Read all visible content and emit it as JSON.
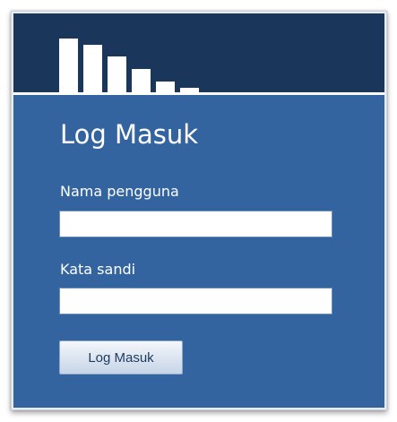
{
  "logo": {
    "icon": "bar-chart-logo-icon",
    "bars": [
      {
        "level": 1.0
      },
      {
        "level": 0.88
      },
      {
        "level": 0.66
      },
      {
        "level": 0.43
      },
      {
        "level": 0.2
      },
      {
        "level": 0.08
      }
    ]
  },
  "login": {
    "title": "Log Masuk",
    "username_label": "Nama pengguna",
    "username_value": "",
    "password_label": "Kata sandi",
    "password_value": "",
    "submit_label": "Log Masuk"
  },
  "colors": {
    "header": "#1b365b",
    "panel": "#3464a0",
    "text": "#ffffff",
    "button_text": "#1e3a5f"
  }
}
